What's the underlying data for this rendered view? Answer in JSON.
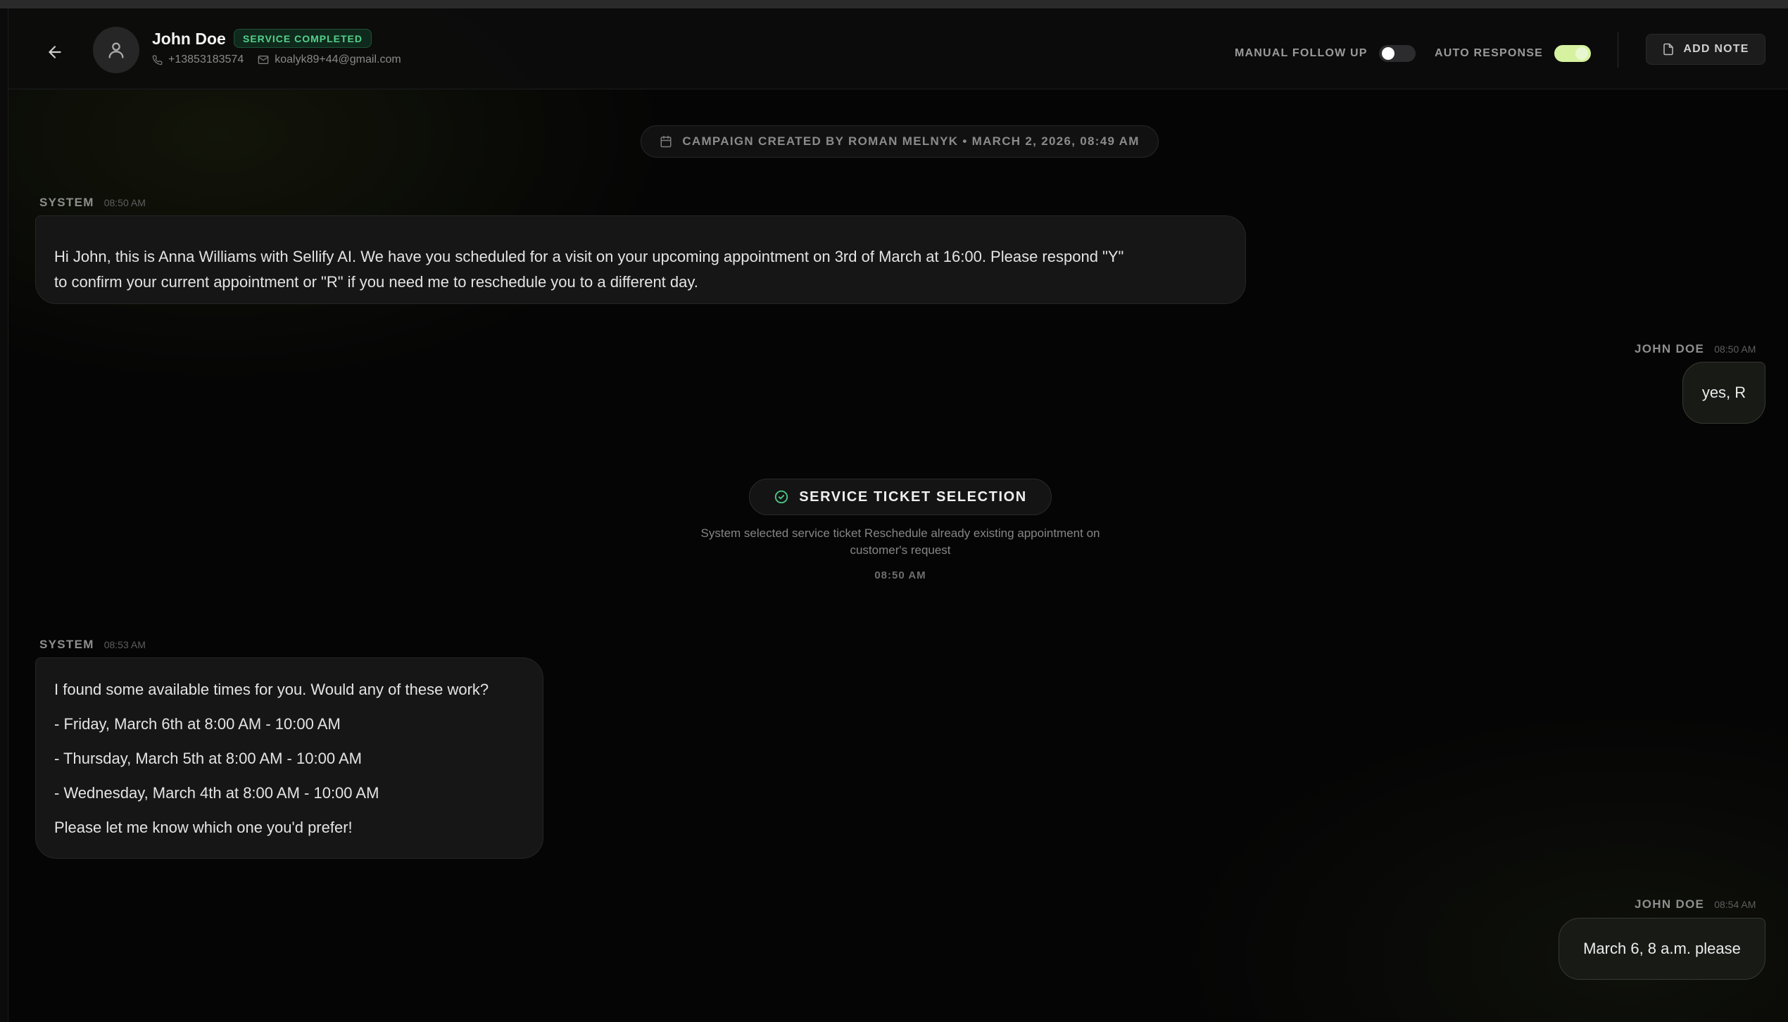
{
  "colors": {
    "background": "#050505",
    "accent_toggle_on": "#d6f2a0",
    "status_badge_text": "#53d18c",
    "status_badge_bg": "#0f2a1c"
  },
  "header": {
    "back_icon": "arrow-left-icon",
    "avatar_icon": "user-icon",
    "contact_name": "John Doe",
    "status_badge": "SERVICE COMPLETED",
    "phone": "+13853183574",
    "email": "koalyk89+44@gmail.com",
    "manual_follow_up_label": "MANUAL FOLLOW UP",
    "manual_follow_up_on": false,
    "auto_response_label": "AUTO RESPONSE",
    "auto_response_on": true,
    "add_note_label": "ADD NOTE"
  },
  "campaign": {
    "text": "CAMPAIGN CREATED BY ROMAN MELNYK • MARCH 2, 2026, 08:49 AM"
  },
  "messages": [
    {
      "sender": "SYSTEM",
      "time": "08:50 AM",
      "lines": [
        "Hi John, this is Anna Williams with Sellify AI. We have you scheduled for a visit on your upcoming appointment on 3rd of March at 16:00. Please respond \"Y\"",
        "to confirm your current appointment or \"R\" if you need me to reschedule you to a different day."
      ]
    },
    {
      "sender": "JOHN DOE",
      "time": "08:50 AM",
      "text": "yes, R"
    },
    {
      "sender": "SYSTEM",
      "time": "08:53 AM",
      "lines": [
        "I found some available times for you. Would any of these work?",
        "- Friday, March 6th at 8:00 AM - 10:00 AM",
        "- Thursday, March 5th at 8:00 AM - 10:00 AM",
        "- Wednesday, March 4th at 8:00 AM - 10:00 AM",
        "Please let me know which one you'd prefer!"
      ]
    },
    {
      "sender": "JOHN DOE",
      "time": "08:54 AM",
      "text": "March 6, 8 a.m. please"
    }
  ],
  "ticket_event": {
    "title": "SERVICE TICKET SELECTION",
    "description_line1": "System selected service ticket Reschedule already existing appointment on",
    "description_line2": "customer's request",
    "time": "08:50 AM"
  }
}
